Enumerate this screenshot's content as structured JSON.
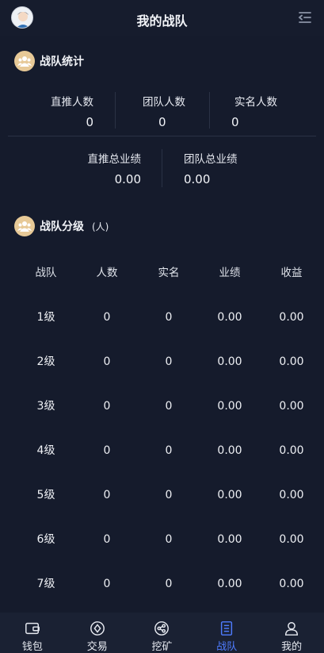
{
  "header": {
    "title": "我的战队"
  },
  "team_stats": {
    "title": "战队统计",
    "direct_count": {
      "label": "直推人数",
      "value": "0"
    },
    "team_count": {
      "label": "团队人数",
      "value": "0"
    },
    "verified_count": {
      "label": "实名人数",
      "value": "0"
    },
    "direct_performance": {
      "label": "直推总业绩",
      "value": "0.00"
    },
    "team_performance": {
      "label": "团队总业绩",
      "value": "0.00"
    }
  },
  "team_levels": {
    "title": "战队分级",
    "unit": "(人)",
    "columns": [
      "战队",
      "人数",
      "实名",
      "业绩",
      "收益"
    ],
    "rows": [
      [
        "1级",
        "0",
        "0",
        "0.00",
        "0.00"
      ],
      [
        "2级",
        "0",
        "0",
        "0.00",
        "0.00"
      ],
      [
        "3级",
        "0",
        "0",
        "0.00",
        "0.00"
      ],
      [
        "4级",
        "0",
        "0",
        "0.00",
        "0.00"
      ],
      [
        "5级",
        "0",
        "0",
        "0.00",
        "0.00"
      ],
      [
        "6级",
        "0",
        "0",
        "0.00",
        "0.00"
      ],
      [
        "7级",
        "0",
        "0",
        "0.00",
        "0.00"
      ]
    ]
  },
  "nav": {
    "active": "战队",
    "accent": "#4f7cff",
    "items": [
      {
        "label": "钱包",
        "icon": "wallet-icon"
      },
      {
        "label": "交易",
        "icon": "trade-icon"
      },
      {
        "label": "挖矿",
        "icon": "mining-icon"
      },
      {
        "label": "战队",
        "icon": "team-icon"
      },
      {
        "label": "我的",
        "icon": "profile-icon"
      }
    ]
  }
}
